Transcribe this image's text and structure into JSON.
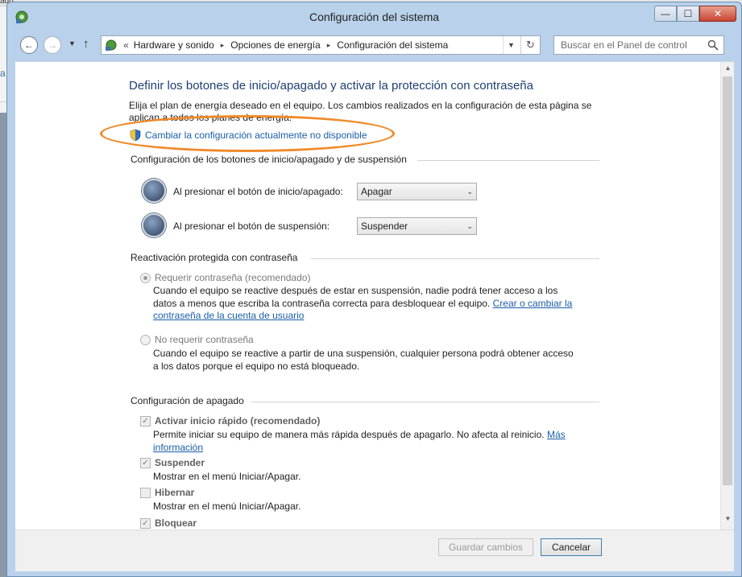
{
  "background_app": {
    "top_label": "ado",
    "left_text": "a"
  },
  "window": {
    "title": "Configuración del sistema",
    "controls": {
      "minimize": "—",
      "maximize": "☐",
      "close": "✕"
    }
  },
  "nav": {
    "back": "←",
    "forward": "→",
    "dropdown": "▼",
    "up": "↑",
    "address": {
      "lead": "«",
      "crumbs": [
        "Hardware y sonido",
        "Opciones de energía",
        "Configuración del sistema"
      ],
      "sep": "▸",
      "dropdown": "▼",
      "refresh": "↻"
    },
    "search": {
      "placeholder": "Buscar en el Panel de control"
    }
  },
  "page": {
    "title": "Definir los botones de inicio/apagado y activar la protección con contraseña",
    "description": "Elija el plan de energía deseado en el equipo. Los cambios realizados en la configuración de esta página se aplican a todos los planes de energía.",
    "change_link": "Cambiar la configuración actualmente no disponible"
  },
  "power_buttons": {
    "heading": "Configuración de los botones de inicio/apagado y de suspensión",
    "rows": [
      {
        "label": "Al presionar el botón de inicio/apagado:",
        "value": "Apagar"
      },
      {
        "label": "Al presionar el botón de suspensión:",
        "value": "Suspender"
      }
    ],
    "select_arrow": "⌄"
  },
  "password": {
    "heading": "Reactivación protegida con contraseña",
    "require": {
      "label": "Requerir contraseña (recomendado)",
      "text": "Cuando el equipo se reactive después de estar en suspensión, nadie podrá tener acceso a los datos a menos que escriba la contraseña correcta para desbloquear el equipo.",
      "link": "Crear o cambiar la contraseña de la cuenta de usuario"
    },
    "no_require": {
      "label": "No requerir contraseña",
      "text": "Cuando el equipo se reactive a partir de una suspensión, cualquier persona podrá obtener acceso a los datos porque el equipo no está bloqueado."
    }
  },
  "shutdown": {
    "heading": "Configuración de apagado",
    "check_mark": "✓",
    "items": [
      {
        "label": "Activar inicio rápido (recomendado)",
        "text": "Permite iniciar su equipo de manera más rápida después de apagarlo. No afecta al reinicio.",
        "link": "Más información",
        "checked": true
      },
      {
        "label": "Suspender",
        "text": "Mostrar en el menú Iniciar/Apagar.",
        "checked": true
      },
      {
        "label": "Hibernar",
        "text": "Mostrar en el menú Iniciar/Apagar.",
        "checked": false
      },
      {
        "label": "Bloquear",
        "checked": true
      }
    ]
  },
  "scrollbar": {
    "up": "▲",
    "down": "▼"
  },
  "footer": {
    "save": "Guardar cambios",
    "cancel": "Cancelar"
  },
  "colors": {
    "link": "#1a5ea8",
    "title": "#1e3f73",
    "highlight": "#f08a2a",
    "frame": "#b9d1ea"
  }
}
